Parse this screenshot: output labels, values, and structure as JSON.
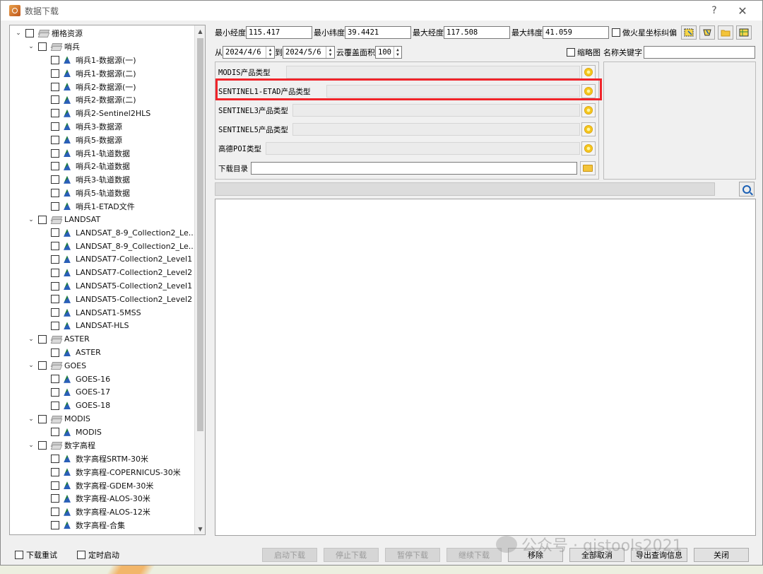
{
  "window": {
    "title": "数据下载",
    "help_label": "?",
    "close_label": "✕"
  },
  "tree": {
    "items": [
      {
        "level": 0,
        "kind": "group",
        "expanded": true,
        "label": "栅格资源"
      },
      {
        "level": 1,
        "kind": "group",
        "expanded": true,
        "label": "哨兵"
      },
      {
        "level": 2,
        "kind": "leaf",
        "label": "哨兵1-数据源(一)"
      },
      {
        "level": 2,
        "kind": "leaf",
        "label": "哨兵1-数据源(二)"
      },
      {
        "level": 2,
        "kind": "leaf",
        "label": "哨兵2-数据源(一)"
      },
      {
        "level": 2,
        "kind": "leaf",
        "label": "哨兵2-数据源(二)"
      },
      {
        "level": 2,
        "kind": "leaf",
        "label": "哨兵2-Sentinel2HLS"
      },
      {
        "level": 2,
        "kind": "leaf",
        "label": "哨兵3-数据源"
      },
      {
        "level": 2,
        "kind": "leaf",
        "label": "哨兵5-数据源"
      },
      {
        "level": 2,
        "kind": "leaf",
        "label": "哨兵1-轨道数据"
      },
      {
        "level": 2,
        "kind": "leaf",
        "label": "哨兵2-轨道数据"
      },
      {
        "level": 2,
        "kind": "leaf",
        "label": "哨兵3-轨道数据"
      },
      {
        "level": 2,
        "kind": "leaf",
        "label": "哨兵5-轨道数据"
      },
      {
        "level": 2,
        "kind": "leaf",
        "label": "哨兵1-ETAD文件"
      },
      {
        "level": 1,
        "kind": "group",
        "expanded": true,
        "label": "LANDSAT"
      },
      {
        "level": 2,
        "kind": "leaf",
        "label": "LANDSAT_8-9_Collection2_Le..."
      },
      {
        "level": 2,
        "kind": "leaf",
        "label": "LANDSAT_8-9_Collection2_Le..."
      },
      {
        "level": 2,
        "kind": "leaf",
        "label": "LANDSAT7-Collection2_Level1"
      },
      {
        "level": 2,
        "kind": "leaf",
        "label": "LANDSAT7-Collection2_Level2"
      },
      {
        "level": 2,
        "kind": "leaf",
        "label": "LANDSAT5-Collection2_Level1"
      },
      {
        "level": 2,
        "kind": "leaf",
        "label": "LANDSAT5-Collection2_Level2"
      },
      {
        "level": 2,
        "kind": "leaf",
        "label": "LANDSAT1-5MSS"
      },
      {
        "level": 2,
        "kind": "leaf",
        "label": "LANDSAT-HLS"
      },
      {
        "level": 1,
        "kind": "group",
        "expanded": true,
        "label": "ASTER"
      },
      {
        "level": 2,
        "kind": "leaf",
        "label": "ASTER"
      },
      {
        "level": 1,
        "kind": "group",
        "expanded": true,
        "label": "GOES"
      },
      {
        "level": 2,
        "kind": "leaf",
        "label": "GOES-16"
      },
      {
        "level": 2,
        "kind": "leaf",
        "label": "GOES-17"
      },
      {
        "level": 2,
        "kind": "leaf",
        "label": "GOES-18"
      },
      {
        "level": 1,
        "kind": "group",
        "expanded": true,
        "label": "MODIS"
      },
      {
        "level": 2,
        "kind": "leaf",
        "label": "MODIS"
      },
      {
        "level": 1,
        "kind": "group",
        "expanded": true,
        "label": "数字高程"
      },
      {
        "level": 2,
        "kind": "leaf",
        "label": "数字高程SRTM-30米"
      },
      {
        "level": 2,
        "kind": "leaf",
        "label": "数字高程-COPERNICUS-30米"
      },
      {
        "level": 2,
        "kind": "leaf",
        "label": "数字高程-GDEM-30米"
      },
      {
        "level": 2,
        "kind": "leaf",
        "label": "数字高程-ALOS-30米"
      },
      {
        "level": 2,
        "kind": "leaf",
        "label": "数字高程-ALOS-12米"
      },
      {
        "level": 2,
        "kind": "leaf",
        "label": "数字高程-合集"
      }
    ]
  },
  "bbox": {
    "min_lon_label": "最小经度",
    "min_lon_value": "115.417",
    "min_lat_label": "最小纬度",
    "min_lat_value": "39.4421",
    "max_lon_label": "最大经度",
    "max_lon_value": "117.508",
    "max_lat_label": "最大纬度",
    "max_lat_value": "41.059",
    "mars_label": "做火星坐标纠偏"
  },
  "filters": {
    "from_label": "从",
    "from_value": "2024/4/6",
    "to_label": "到",
    "to_value": "2024/5/6",
    "cloud_label": "云覆盖面积",
    "cloud_value": "100",
    "thumbnail_label": "缩略图",
    "keyword_label": "名称关键字",
    "keyword_value": ""
  },
  "products": {
    "rows": [
      {
        "label": "MODIS产品类型"
      },
      {
        "label": "SENTINEL1-ETAD产品类型"
      },
      {
        "label": "SENTINEL3产品类型"
      },
      {
        "label": "SENTINEL5产品类型"
      },
      {
        "label": "高德POI类型"
      }
    ],
    "download_dir_label": "下载目录",
    "download_dir_value": ""
  },
  "bottom": {
    "redownload_label": "下载重试",
    "timed_start_label": "定时启动",
    "start_label": "启动下载",
    "stop_label": "停止下载",
    "pause_label": "暂停下载",
    "continue_label": "继续下载",
    "remove_label": "移除",
    "cancel_all_label": "全部取消",
    "export_label": "导出查询信息",
    "close_label": "关闭"
  },
  "watermark": {
    "text": "公众号 · gistools2021"
  }
}
